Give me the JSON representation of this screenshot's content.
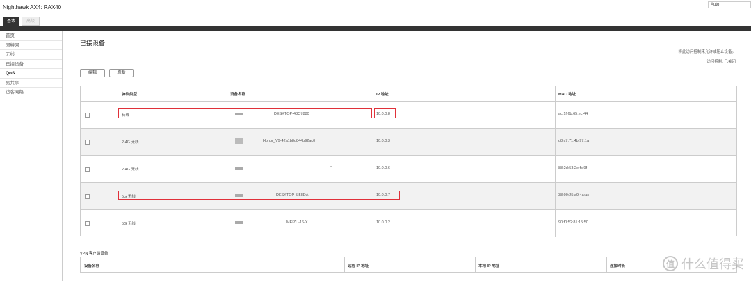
{
  "app": {
    "title": "Nighthawk AX4: RAX40",
    "language": "Auto"
  },
  "tabs": [
    {
      "label": "基本",
      "active": true
    },
    {
      "label": "高级",
      "active": false
    }
  ],
  "sidebar": {
    "items": [
      {
        "label": "首页"
      },
      {
        "label": "因特网"
      },
      {
        "label": "无线"
      },
      {
        "label": "已接设备"
      },
      {
        "label": "QoS"
      },
      {
        "label": "易共享"
      },
      {
        "label": "访客网络"
      }
    ]
  },
  "page": {
    "title": "已接设备",
    "access_note_pre": "将此",
    "access_note_link": "访问控制",
    "access_note_post": "来允许或阻止设备。",
    "access_status": "访问控制: 已关闭",
    "edit_button": "编辑",
    "refresh_button": "刷新"
  },
  "table": {
    "headers": [
      "协议类型",
      "设备名称",
      "IP 地址",
      "MAC 地址"
    ],
    "rows": [
      {
        "type": "有线",
        "name": "DESKTOP-48Q7880",
        "ip": "10.0.0.8",
        "mac": "ac:1f:6b:65:ec:44"
      },
      {
        "type": "2.4G 无线",
        "name": "Honor_V9-42a1b8d844b92ac0",
        "ip": "10.0.0.3",
        "mac": "d8:c7:71:4b:97:1a"
      },
      {
        "type": "2.4G 无线",
        "name": "*",
        "ip": "10.0.0.6",
        "mac": "88:2d:53:2e:fc:9f"
      },
      {
        "type": "5G 无线",
        "name": "DESKTOP-5I5IIDA",
        "ip": "10.0.0.7",
        "mac": "38:00:25:a9:4a:ac"
      },
      {
        "type": "5G 无线",
        "name": "MEIZU-16-X",
        "ip": "10.0.0.2",
        "mac": "90:f0:52:81:15:50"
      }
    ]
  },
  "vpn": {
    "title": "VPN 客户端设备",
    "headers": [
      "设备名称",
      "远程 IP 地址",
      "本地 IP 地址",
      "连接时长"
    ]
  },
  "watermark": {
    "logo": "值",
    "text": "什么值得买"
  },
  "colors": {
    "highlight": "#e0313a",
    "dark_bar": "#333333"
  }
}
